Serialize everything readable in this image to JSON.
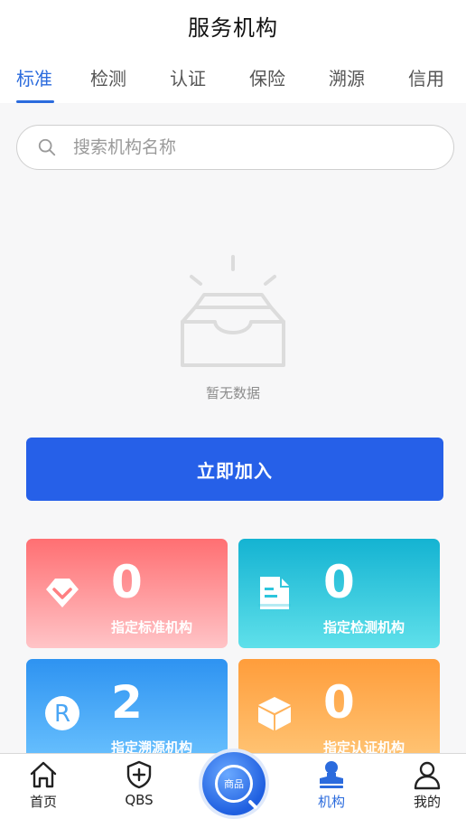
{
  "header": {
    "title": "服务机构"
  },
  "tabs": [
    {
      "label": "标准",
      "active": true
    },
    {
      "label": "检测",
      "active": false
    },
    {
      "label": "认证",
      "active": false
    },
    {
      "label": "保险",
      "active": false
    },
    {
      "label": "溯源",
      "active": false
    },
    {
      "label": "信用",
      "active": false
    }
  ],
  "search": {
    "placeholder": "搜索机构名称",
    "value": "",
    "icon": "search-icon"
  },
  "empty_state": {
    "text": "暂无数据",
    "icon": "empty-inbox-icon"
  },
  "join_button": {
    "label": "立即加入"
  },
  "cards": [
    {
      "count": "0",
      "label": "指定标准机构",
      "icon": "diamond-icon",
      "colors": [
        "#ff6f72",
        "#ffc4c7"
      ]
    },
    {
      "count": "0",
      "label": "指定检测机构",
      "icon": "document-icon",
      "colors": [
        "#14b3d2",
        "#5fe0ea"
      ]
    },
    {
      "count": "2",
      "label": "指定溯源机构",
      "icon": "registered-icon",
      "colors": [
        "#2e93f1",
        "#6dc4ff"
      ]
    },
    {
      "count": "0",
      "label": "指定认证机构",
      "icon": "cube-icon",
      "colors": [
        "#ff9d3b",
        "#ffc87a"
      ]
    }
  ],
  "bottom_nav": {
    "items": [
      {
        "label": "首页",
        "icon": "home-icon",
        "active": false
      },
      {
        "label": "QBS",
        "icon": "shield-plus-icon",
        "active": false
      },
      {
        "label": "机构",
        "icon": "stamp-icon",
        "active": true
      },
      {
        "label": "我的",
        "icon": "user-icon",
        "active": false
      }
    ],
    "center": {
      "label": "商品",
      "icon": "magnifier-icon"
    }
  },
  "colors": {
    "accent": "#2b6bdd",
    "button": "#2660e8"
  }
}
